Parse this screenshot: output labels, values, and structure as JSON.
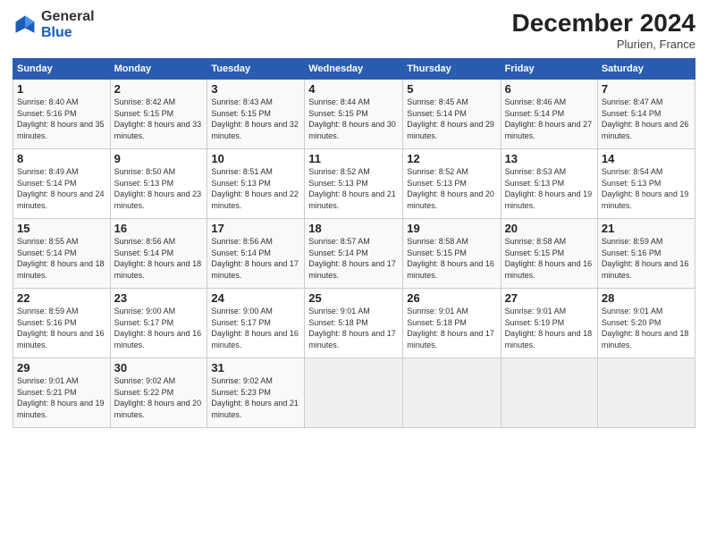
{
  "header": {
    "logo_general": "General",
    "logo_blue": "Blue",
    "title": "December 2024",
    "subtitle": "Plurien, France"
  },
  "columns": [
    "Sunday",
    "Monday",
    "Tuesday",
    "Wednesday",
    "Thursday",
    "Friday",
    "Saturday"
  ],
  "weeks": [
    [
      {
        "day": "1",
        "sunrise": "Sunrise: 8:40 AM",
        "sunset": "Sunset: 5:16 PM",
        "daylight": "Daylight: 8 hours and 35 minutes."
      },
      {
        "day": "2",
        "sunrise": "Sunrise: 8:42 AM",
        "sunset": "Sunset: 5:15 PM",
        "daylight": "Daylight: 8 hours and 33 minutes."
      },
      {
        "day": "3",
        "sunrise": "Sunrise: 8:43 AM",
        "sunset": "Sunset: 5:15 PM",
        "daylight": "Daylight: 8 hours and 32 minutes."
      },
      {
        "day": "4",
        "sunrise": "Sunrise: 8:44 AM",
        "sunset": "Sunset: 5:15 PM",
        "daylight": "Daylight: 8 hours and 30 minutes."
      },
      {
        "day": "5",
        "sunrise": "Sunrise: 8:45 AM",
        "sunset": "Sunset: 5:14 PM",
        "daylight": "Daylight: 8 hours and 29 minutes."
      },
      {
        "day": "6",
        "sunrise": "Sunrise: 8:46 AM",
        "sunset": "Sunset: 5:14 PM",
        "daylight": "Daylight: 8 hours and 27 minutes."
      },
      {
        "day": "7",
        "sunrise": "Sunrise: 8:47 AM",
        "sunset": "Sunset: 5:14 PM",
        "daylight": "Daylight: 8 hours and 26 minutes."
      }
    ],
    [
      {
        "day": "8",
        "sunrise": "Sunrise: 8:49 AM",
        "sunset": "Sunset: 5:14 PM",
        "daylight": "Daylight: 8 hours and 24 minutes."
      },
      {
        "day": "9",
        "sunrise": "Sunrise: 8:50 AM",
        "sunset": "Sunset: 5:13 PM",
        "daylight": "Daylight: 8 hours and 23 minutes."
      },
      {
        "day": "10",
        "sunrise": "Sunrise: 8:51 AM",
        "sunset": "Sunset: 5:13 PM",
        "daylight": "Daylight: 8 hours and 22 minutes."
      },
      {
        "day": "11",
        "sunrise": "Sunrise: 8:52 AM",
        "sunset": "Sunset: 5:13 PM",
        "daylight": "Daylight: 8 hours and 21 minutes."
      },
      {
        "day": "12",
        "sunrise": "Sunrise: 8:52 AM",
        "sunset": "Sunset: 5:13 PM",
        "daylight": "Daylight: 8 hours and 20 minutes."
      },
      {
        "day": "13",
        "sunrise": "Sunrise: 8:53 AM",
        "sunset": "Sunset: 5:13 PM",
        "daylight": "Daylight: 8 hours and 19 minutes."
      },
      {
        "day": "14",
        "sunrise": "Sunrise: 8:54 AM",
        "sunset": "Sunset: 5:13 PM",
        "daylight": "Daylight: 8 hours and 19 minutes."
      }
    ],
    [
      {
        "day": "15",
        "sunrise": "Sunrise: 8:55 AM",
        "sunset": "Sunset: 5:14 PM",
        "daylight": "Daylight: 8 hours and 18 minutes."
      },
      {
        "day": "16",
        "sunrise": "Sunrise: 8:56 AM",
        "sunset": "Sunset: 5:14 PM",
        "daylight": "Daylight: 8 hours and 18 minutes."
      },
      {
        "day": "17",
        "sunrise": "Sunrise: 8:56 AM",
        "sunset": "Sunset: 5:14 PM",
        "daylight": "Daylight: 8 hours and 17 minutes."
      },
      {
        "day": "18",
        "sunrise": "Sunrise: 8:57 AM",
        "sunset": "Sunset: 5:14 PM",
        "daylight": "Daylight: 8 hours and 17 minutes."
      },
      {
        "day": "19",
        "sunrise": "Sunrise: 8:58 AM",
        "sunset": "Sunset: 5:15 PM",
        "daylight": "Daylight: 8 hours and 16 minutes."
      },
      {
        "day": "20",
        "sunrise": "Sunrise: 8:58 AM",
        "sunset": "Sunset: 5:15 PM",
        "daylight": "Daylight: 8 hours and 16 minutes."
      },
      {
        "day": "21",
        "sunrise": "Sunrise: 8:59 AM",
        "sunset": "Sunset: 5:16 PM",
        "daylight": "Daylight: 8 hours and 16 minutes."
      }
    ],
    [
      {
        "day": "22",
        "sunrise": "Sunrise: 8:59 AM",
        "sunset": "Sunset: 5:16 PM",
        "daylight": "Daylight: 8 hours and 16 minutes."
      },
      {
        "day": "23",
        "sunrise": "Sunrise: 9:00 AM",
        "sunset": "Sunset: 5:17 PM",
        "daylight": "Daylight: 8 hours and 16 minutes."
      },
      {
        "day": "24",
        "sunrise": "Sunrise: 9:00 AM",
        "sunset": "Sunset: 5:17 PM",
        "daylight": "Daylight: 8 hours and 16 minutes."
      },
      {
        "day": "25",
        "sunrise": "Sunrise: 9:01 AM",
        "sunset": "Sunset: 5:18 PM",
        "daylight": "Daylight: 8 hours and 17 minutes."
      },
      {
        "day": "26",
        "sunrise": "Sunrise: 9:01 AM",
        "sunset": "Sunset: 5:18 PM",
        "daylight": "Daylight: 8 hours and 17 minutes."
      },
      {
        "day": "27",
        "sunrise": "Sunrise: 9:01 AM",
        "sunset": "Sunset: 5:19 PM",
        "daylight": "Daylight: 8 hours and 18 minutes."
      },
      {
        "day": "28",
        "sunrise": "Sunrise: 9:01 AM",
        "sunset": "Sunset: 5:20 PM",
        "daylight": "Daylight: 8 hours and 18 minutes."
      }
    ],
    [
      {
        "day": "29",
        "sunrise": "Sunrise: 9:01 AM",
        "sunset": "Sunset: 5:21 PM",
        "daylight": "Daylight: 8 hours and 19 minutes."
      },
      {
        "day": "30",
        "sunrise": "Sunrise: 9:02 AM",
        "sunset": "Sunset: 5:22 PM",
        "daylight": "Daylight: 8 hours and 20 minutes."
      },
      {
        "day": "31",
        "sunrise": "Sunrise: 9:02 AM",
        "sunset": "Sunset: 5:23 PM",
        "daylight": "Daylight: 8 hours and 21 minutes."
      },
      null,
      null,
      null,
      null
    ]
  ]
}
